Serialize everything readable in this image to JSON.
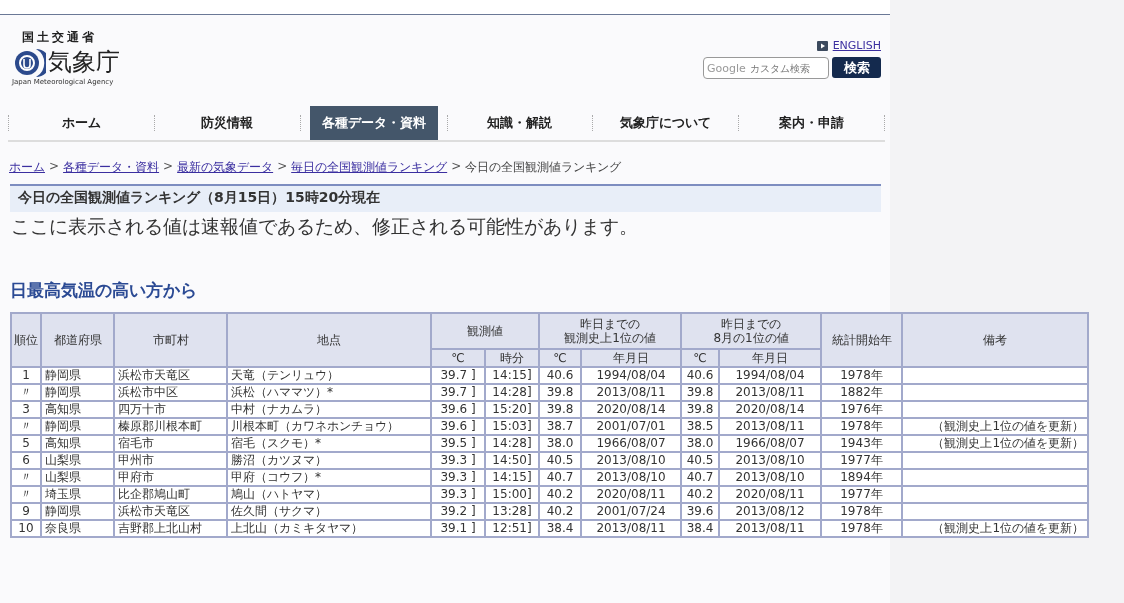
{
  "header": {
    "ministry": "国土交通省",
    "agency": "気象庁",
    "agency_en": "Japan Meteorological Agency",
    "english_link": "ENGLISH",
    "search": {
      "brand": "Google",
      "placeholder": "カスタム検索",
      "button": "検索"
    }
  },
  "nav": [
    {
      "label": "ホーム",
      "selected": false
    },
    {
      "label": "防災情報",
      "selected": false
    },
    {
      "label": "各種データ・資料",
      "selected": true
    },
    {
      "label": "知識・解説",
      "selected": false
    },
    {
      "label": "気象庁について",
      "selected": false
    },
    {
      "label": "案内・申請",
      "selected": false
    }
  ],
  "breadcrumb": {
    "separator": ">",
    "links": [
      "ホーム",
      "各種データ・資料",
      "最新の気象データ",
      "毎日の全国観測値ランキング"
    ],
    "current": "今日の全国観測値ランキング"
  },
  "page_title": "今日の全国観測値ランキング（8月15日）15時20分現在",
  "notice": "ここに表示される値は速報値であるため、修正される可能性があります。",
  "section_title": "日最高気温の高い方から",
  "table": {
    "header_rows": [
      [
        {
          "lines": [
            "順位"
          ],
          "rowspan": 2
        },
        {
          "lines": [
            "都道府県"
          ],
          "rowspan": 2
        },
        {
          "lines": [
            "市町村"
          ],
          "rowspan": 2
        },
        {
          "lines": [
            "地点"
          ],
          "rowspan": 2
        },
        {
          "lines": [
            "観測値"
          ],
          "colspan": 2
        },
        {
          "lines": [
            "昨日までの",
            "観測史上1位の値"
          ],
          "colspan": 2
        },
        {
          "lines": [
            "昨日までの",
            "8月の1位の値"
          ],
          "colspan": 2
        },
        {
          "lines": [
            "統計開始年"
          ],
          "rowspan": 2
        },
        {
          "lines": [
            "備考"
          ],
          "rowspan": 2
        }
      ],
      [
        {
          "lines": [
            "℃"
          ]
        },
        {
          "lines": [
            "時分"
          ]
        },
        {
          "lines": [
            "℃"
          ]
        },
        {
          "lines": [
            "年月日"
          ]
        },
        {
          "lines": [
            "℃"
          ]
        },
        {
          "lines": [
            "年月日"
          ]
        }
      ]
    ],
    "rows": [
      {
        "cells": [
          "1",
          "静岡県",
          "浜松市天竜区",
          "天竜（テンリュウ）",
          "39.7 ]",
          "14:15]",
          "40.6",
          "1994/08/04",
          "40.6",
          "1994/08/04",
          "1978年"
        ]
      },
      {
        "cells": [
          "〃",
          "静岡県",
          "浜松市中区",
          "浜松（ハママツ）*",
          "39.7 ]",
          "14:28]",
          "39.8",
          "2013/08/11",
          "39.8",
          "2013/08/11",
          "1882年"
        ]
      },
      {
        "cells": [
          "3",
          "高知県",
          "四万十市",
          "中村（ナカムラ）",
          "39.6 ]",
          "15:20]",
          "39.8",
          "2020/08/14",
          "39.8",
          "2020/08/14",
          "1976年"
        ]
      },
      {
        "cells": [
          "〃",
          "静岡県",
          "榛原郡川根本町",
          "川根本町（カワネホンチョウ）",
          "39.6 ]",
          "15:03]",
          "38.7",
          "2001/07/01",
          "38.5",
          "2013/08/11",
          "1978年",
          "（観測史上1位の値を更新）"
        ]
      },
      {
        "cells": [
          "5",
          "高知県",
          "宿毛市",
          "宿毛（スクモ）*",
          "39.5 ]",
          "14:28]",
          "38.0",
          "1966/08/07",
          "38.0",
          "1966/08/07",
          "1943年",
          "（観測史上1位の値を更新）"
        ]
      },
      {
        "cells": [
          "6",
          "山梨県",
          "甲州市",
          "勝沼（カツヌマ）",
          "39.3 ]",
          "14:50]",
          "40.5",
          "2013/08/10",
          "40.5",
          "2013/08/10",
          "1977年"
        ]
      },
      {
        "cells": [
          "〃",
          "山梨県",
          "甲府市",
          "甲府（コウフ）*",
          "39.3 ]",
          "14:15]",
          "40.7",
          "2013/08/10",
          "40.7",
          "2013/08/10",
          "1894年"
        ]
      },
      {
        "cells": [
          "〃",
          "埼玉県",
          "比企郡鳩山町",
          "鳩山（ハトヤマ）",
          "39.3 ]",
          "15:00]",
          "40.2",
          "2020/08/11",
          "40.2",
          "2020/08/11",
          "1977年"
        ]
      },
      {
        "cells": [
          "9",
          "静岡県",
          "浜松市天竜区",
          "佐久間（サクマ）",
          "39.2 ]",
          "13:28]",
          "40.2",
          "2001/07/24",
          "39.6",
          "2013/08/12",
          "1978年"
        ]
      },
      {
        "cells": [
          "10",
          "奈良県",
          "吉野郡上北山村",
          "上北山（カミキタヤマ）",
          "39.1 ]",
          "12:51]",
          "38.4",
          "2013/08/11",
          "38.4",
          "2013/08/11",
          "1978年",
          "（観測史上1位の値を更新）"
        ]
      }
    ]
  }
}
